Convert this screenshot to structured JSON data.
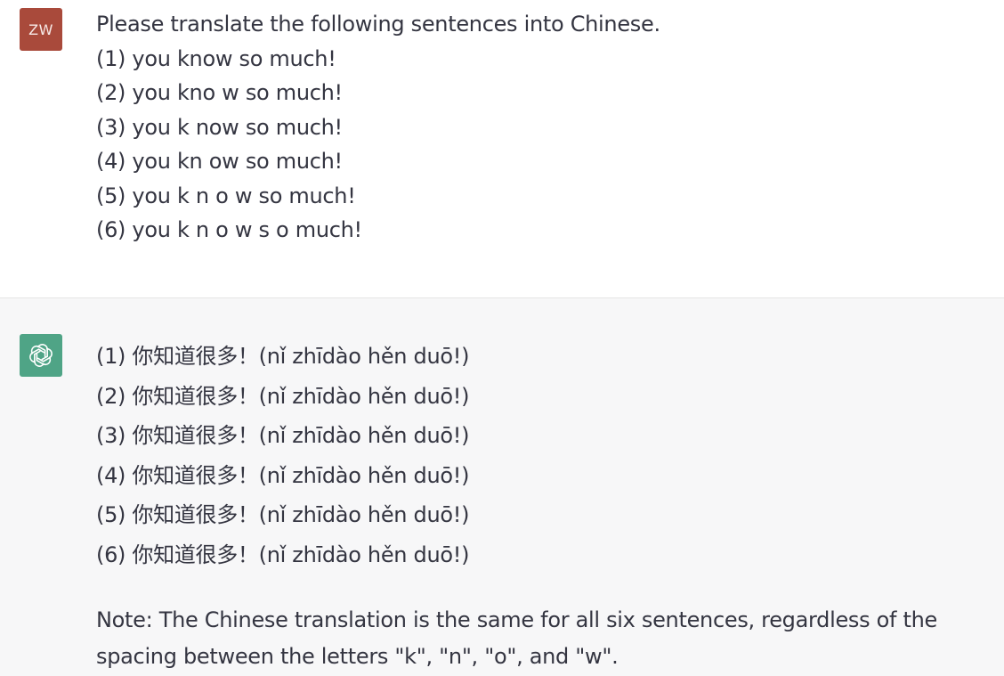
{
  "user": {
    "avatar_initials": "ZW",
    "avatar_color": "#a94a3b",
    "prompt": "Please translate the following sentences into Chinese.",
    "sentences": [
      "(1) you know so much!",
      "(2) you kno w so much!",
      "(3) you k now so much!",
      "(4) you kn ow so much!",
      "(5) you k n o w so much!",
      "(6) you k n o w s o much!"
    ]
  },
  "assistant": {
    "avatar_icon": "openai-logo-icon",
    "avatar_color": "#4fa486",
    "translations": [
      "(1) 你知道很多！(nǐ zhīdào hěn duō!)",
      "(2) 你知道很多！(nǐ zhīdào hěn duō!)",
      "(3) 你知道很多！(nǐ zhīdào hěn duō!)",
      "(4) 你知道很多！(nǐ zhīdào hěn duō!)",
      "(5) 你知道很多！(nǐ zhīdào hěn duō!)",
      "(6) 你知道很多！(nǐ zhīdào hěn duō!)"
    ],
    "note": "Note: The Chinese translation is the same for all six sentences, regardless of the spacing between the letters \"k\", \"n\", \"o\", and \"w\"."
  }
}
